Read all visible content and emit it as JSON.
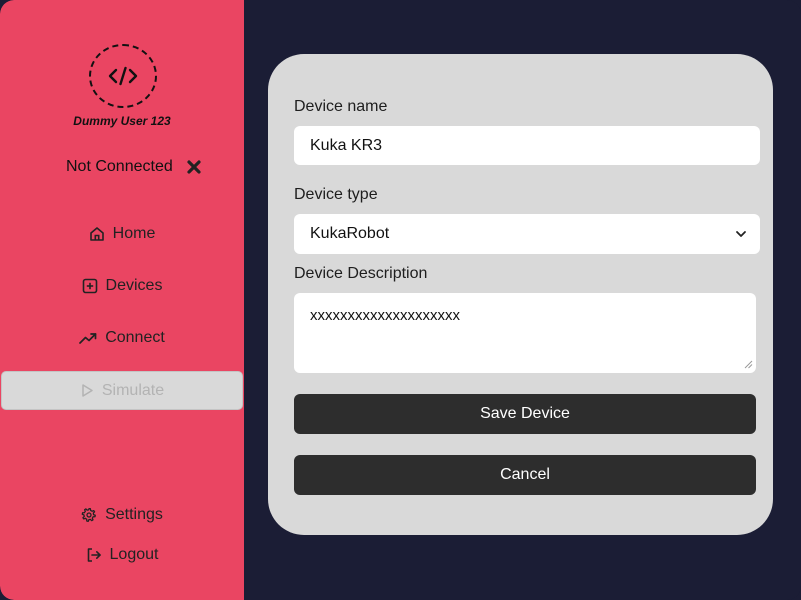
{
  "sidebar": {
    "username": "Dummy User 123",
    "connection_status": "Not Connected",
    "nav": {
      "home": "Home",
      "devices": "Devices",
      "connect": "Connect",
      "simulate": "Simulate",
      "settings": "Settings",
      "logout": "Logout"
    }
  },
  "form": {
    "name_label": "Device name",
    "name_value": "Kuka KR3",
    "type_label": "Device type",
    "type_value": "KukaRobot",
    "description_label": "Device Description",
    "description_value": "xxxxxxxxxxxxxxxxxxxx",
    "save_label": "Save Device",
    "cancel_label": "Cancel"
  },
  "colors": {
    "sidebar_bg": "#ea4562",
    "main_bg": "#1b1d35",
    "card_bg": "#d9d9d9",
    "button_bg": "#2d2d2d"
  },
  "icons": {
    "logo": "code-icon",
    "status": "close-icon",
    "home": "home-icon",
    "devices": "plus-square-icon",
    "connect": "trending-up-icon",
    "simulate": "play-icon",
    "settings": "gear-icon",
    "logout": "logout-icon"
  }
}
